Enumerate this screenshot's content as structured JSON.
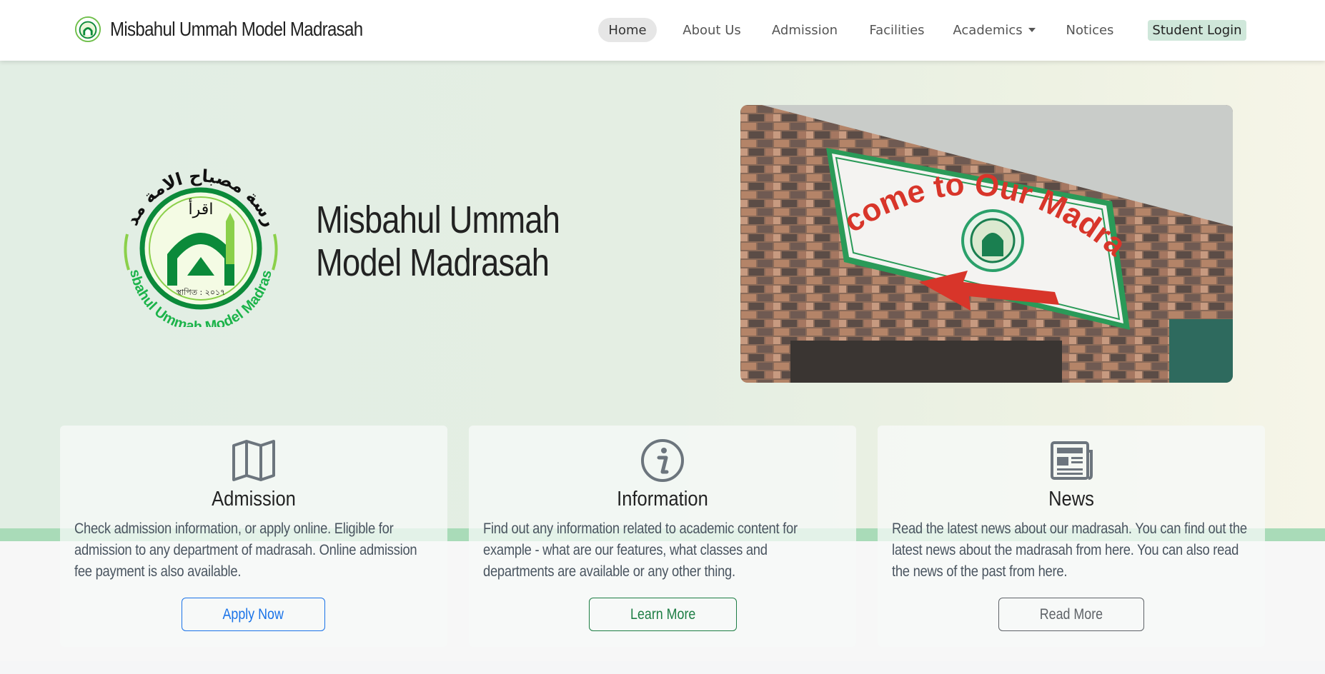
{
  "brand": {
    "name": "Misbahul Ummah Model Madrasah"
  },
  "nav": {
    "items": [
      "Home",
      "About Us",
      "Admission",
      "Facilities",
      "Academics",
      "Notices"
    ],
    "active": "Home",
    "login_label": "Student Login"
  },
  "hero": {
    "title_line1": "Misbahul Ummah",
    "title_line2": "Model Madrasah",
    "logo_arabic": "مدرسة مصباح الامة مديل",
    "logo_iqra": "اقرأ",
    "logo_english": "Misbahul Ummah Model Madrasah",
    "logo_est": "স্থাপিত : ২০১৭",
    "photo_sign_text": "Welcome to Our Madrasah"
  },
  "cards": [
    {
      "icon": "map-icon",
      "title": "Admission",
      "text": "Check admission information, or apply online. Eligible for admission to any department of madrasah. Online admission fee payment is also available.",
      "button": "Apply Now",
      "button_color": "#1a73e8"
    },
    {
      "icon": "info-icon",
      "title": "Information",
      "text": "Find out any information related to academic content for example - what are our features, what classes and departments are available or any other thing.",
      "button": "Learn More",
      "button_color": "#1e7e45"
    },
    {
      "icon": "newspaper-icon",
      "title": "News",
      "text": "Read the latest news about our madrasah. You can find out the latest news about the madrasah from here. You can also read the news of the past from here.",
      "button": "Read More",
      "button_color": "#5f6368"
    }
  ],
  "colors": {
    "accent_green": "#0b8a3a",
    "strip": "#a9dbb8",
    "login_bg": "#cfe7da"
  }
}
